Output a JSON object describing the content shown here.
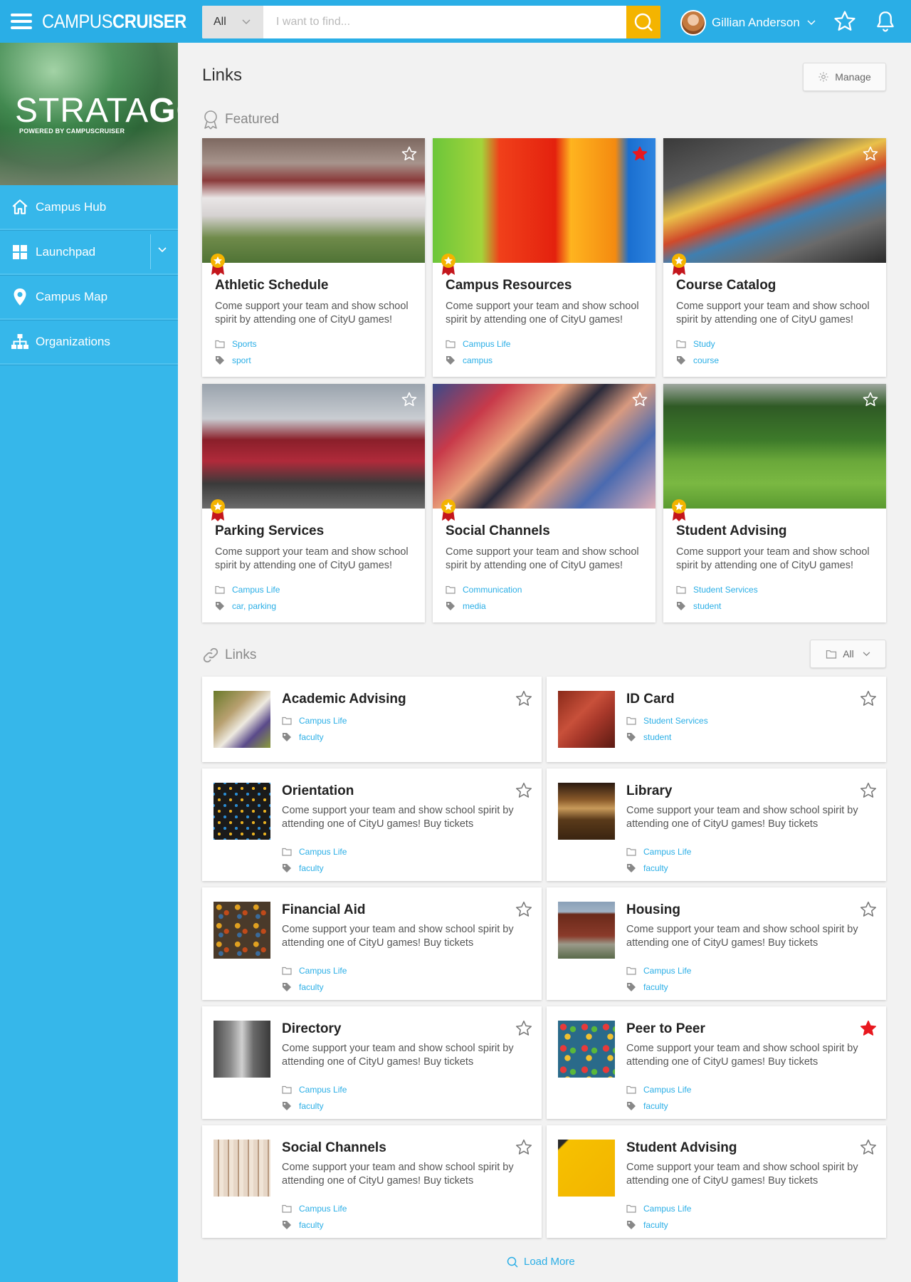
{
  "app": {
    "brand_a": "CAMPUS",
    "brand_b": "CRUISER"
  },
  "search": {
    "scope": "All",
    "placeholder": "I want to find..."
  },
  "user": {
    "name": "Gillian Anderson"
  },
  "sidebar": {
    "logo_a": "STRATA",
    "logo_b": "GO",
    "logo_sub": "POWERED BY CAMPUSCRUISER",
    "items": [
      {
        "label": "Campus Hub",
        "icon": "home-icon"
      },
      {
        "label": "Launchpad",
        "icon": "grid-icon"
      },
      {
        "label": "Campus Map",
        "icon": "map-pin-icon"
      },
      {
        "label": "Organizations",
        "icon": "org-chart-icon"
      }
    ]
  },
  "main": {
    "title": "Links",
    "manage_label": "Manage",
    "featured_label": "Featured",
    "links_label": "Links",
    "filter_label": "All",
    "load_more": "Load More"
  },
  "featured": [
    {
      "title": "Athletic Schedule",
      "desc": "Come support your team and show school spirit by attending one of CityU games!",
      "category": "Sports",
      "tags": "sport",
      "starred": false
    },
    {
      "title": "Campus Resources",
      "desc": "Come support your team and show school spirit by attending one of CityU games!",
      "category": "Campus Life",
      "tags": "campus",
      "starred": true
    },
    {
      "title": "Course Catalog",
      "desc": "Come support your team and show school spirit by attending one of CityU games!",
      "category": "Study",
      "tags": "course",
      "starred": false
    },
    {
      "title": "Parking Services",
      "desc": "Come support your team and show school spirit by attending one of CityU games!",
      "category": "Campus Life",
      "tags": "car, parking",
      "starred": false
    },
    {
      "title": "Social Channels",
      "desc": "Come support your team and show school spirit by attending one of CityU games!",
      "category": "Communication",
      "tags": "media",
      "starred": false
    },
    {
      "title": "Student Advising",
      "desc": "Come support your team and show school spirit by attending one of CityU games!",
      "category": "Student Services",
      "tags": "student",
      "starred": false
    }
  ],
  "links": [
    {
      "title": "Academic Advising",
      "desc": "",
      "category": "Campus Life",
      "tags": "faculty",
      "starred": false
    },
    {
      "title": "ID Card",
      "desc": "",
      "category": "Student Services",
      "tags": "student",
      "starred": false
    },
    {
      "title": "Orientation",
      "desc": "Come support your team and show school spirit by attending one of CityU games! Buy tickets",
      "category": "Campus Life",
      "tags": "faculty",
      "starred": false
    },
    {
      "title": "Library",
      "desc": "Come support your team and show school spirit by attending one of CityU games! Buy tickets",
      "category": "Campus Life",
      "tags": "faculty",
      "starred": false
    },
    {
      "title": "Financial Aid",
      "desc": "Come support your team and show school spirit by attending one of CityU games! Buy tickets",
      "category": "Campus Life",
      "tags": "faculty",
      "starred": false
    },
    {
      "title": "Housing",
      "desc": "Come support your team and show school spirit by attending one of CityU games! Buy tickets",
      "category": "Campus Life",
      "tags": "faculty",
      "starred": false
    },
    {
      "title": "Directory",
      "desc": "Come support your team and show school spirit by attending one of CityU games! Buy tickets",
      "category": "Campus Life",
      "tags": "faculty",
      "starred": false
    },
    {
      "title": "Peer to Peer",
      "desc": "Come support your team and show school spirit by attending one of CityU games! Buy tickets",
      "category": "Campus Life",
      "tags": "faculty",
      "starred": true
    },
    {
      "title": "Social Channels",
      "desc": "Come support your team and show school spirit by attending one of CityU games! Buy tickets",
      "category": "Campus Life",
      "tags": "faculty",
      "starred": false
    },
    {
      "title": "Student Advising",
      "desc": "Come support your team and show school spirit by attending one of CityU games! Buy tickets",
      "category": "Campus Life",
      "tags": "faculty",
      "starred": false
    }
  ],
  "colors": {
    "accent": "#2aaee6",
    "sidebar": "#36b7ea",
    "search_button": "#f4b400",
    "star_active": "#e8181f"
  }
}
